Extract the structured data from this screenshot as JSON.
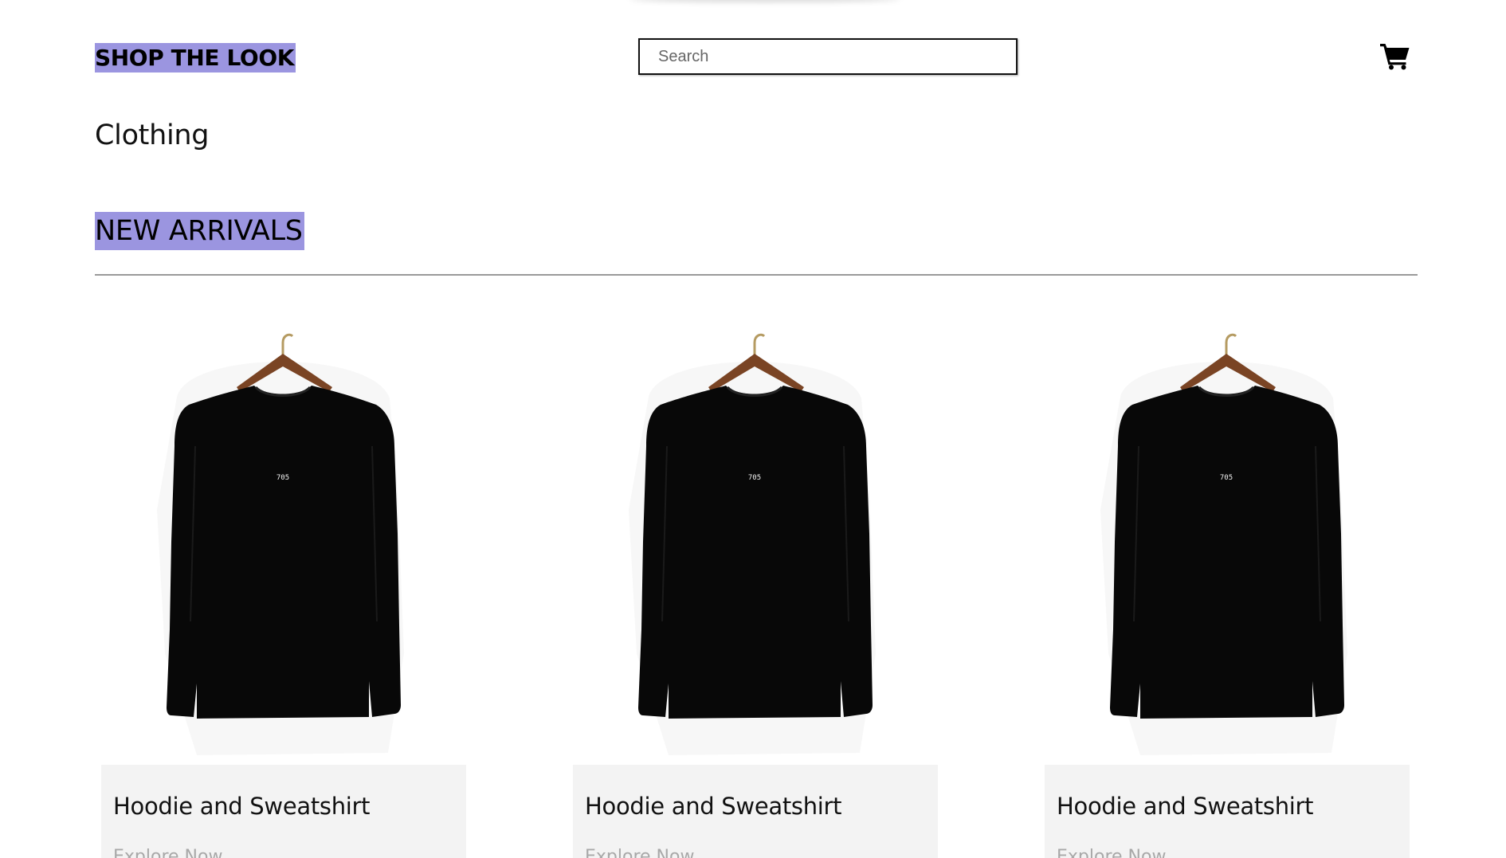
{
  "header": {
    "brand": "SHOP THE LOOK",
    "search_placeholder": "Search",
    "cart_icon": "shopping-cart-icon"
  },
  "page": {
    "category_title": "Clothing",
    "section_heading": "NEW ARRIVALS"
  },
  "products": [
    {
      "title": "Hoodie and Sweatshirt",
      "link_label": "Explore Now",
      "image_icon": "sweatshirt-on-hanger",
      "print_text": "705"
    },
    {
      "title": "Hoodie and Sweatshirt",
      "link_label": "Explore Now",
      "image_icon": "sweatshirt-on-hanger",
      "print_text": "705"
    },
    {
      "title": "Hoodie and Sweatshirt",
      "link_label": "Explore Now",
      "image_icon": "sweatshirt-on-hanger",
      "print_text": "705"
    }
  ],
  "colors": {
    "highlight": "#9b95e0",
    "card_background": "#f3f3f3",
    "link_text": "#a8a8a8",
    "sweatshirt": "#080808",
    "hanger_wood": "#7a4424",
    "hanger_hook": "#b59b62"
  }
}
